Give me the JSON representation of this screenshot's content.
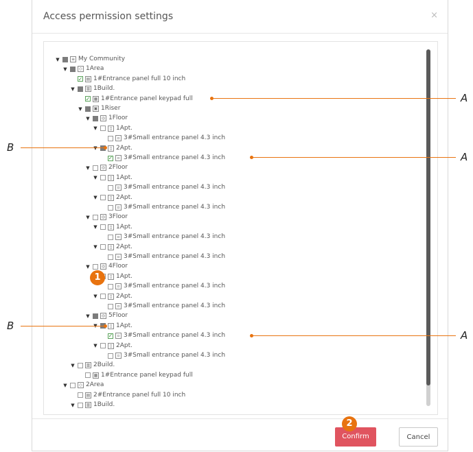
{
  "dialog": {
    "title": "Access permission settings",
    "close_glyph": "×",
    "confirm_label": "Confirm",
    "cancel_label": "Cancel"
  },
  "tree": [
    {
      "twisty": true,
      "check": "partial",
      "icon": "community-icon",
      "label": "My Community",
      "depth": 0
    },
    {
      "twisty": true,
      "check": "partial",
      "icon": "area-icon",
      "label": "1Area",
      "depth": 1
    },
    {
      "twisty": false,
      "check": "checked",
      "icon": "panel-icon",
      "label": "1#Entrance panel full 10 inch",
      "depth": 2
    },
    {
      "twisty": true,
      "check": "partial",
      "icon": "building-icon",
      "label": "1Build.",
      "depth": 2
    },
    {
      "twisty": false,
      "check": "checked",
      "icon": "keypad-icon",
      "label": "1#Entrance panel keypad full",
      "depth": 3
    },
    {
      "twisty": true,
      "check": "partial",
      "icon": "riser-icon",
      "label": "1Riser",
      "depth": 3
    },
    {
      "twisty": true,
      "check": "partial",
      "icon": "floor-icon",
      "label": "1Floor",
      "depth": 4
    },
    {
      "twisty": true,
      "check": "unchecked",
      "icon": "apartment-icon",
      "label": "1Apt.",
      "depth": 5
    },
    {
      "twisty": false,
      "check": "unchecked",
      "icon": "small-panel-icon",
      "label": "3#Small entrance panel 4.3 inch",
      "depth": 6
    },
    {
      "twisty": true,
      "check": "partial",
      "icon": "apartment-icon",
      "label": "2Apt.",
      "depth": 5
    },
    {
      "twisty": false,
      "check": "checked",
      "icon": "small-panel-icon",
      "label": "3#Small entrance panel 4.3 inch",
      "depth": 6
    },
    {
      "twisty": true,
      "check": "unchecked",
      "icon": "floor-icon",
      "label": "2Floor",
      "depth": 4
    },
    {
      "twisty": true,
      "check": "unchecked",
      "icon": "apartment-icon",
      "label": "1Apt.",
      "depth": 5
    },
    {
      "twisty": false,
      "check": "unchecked",
      "icon": "small-panel-icon",
      "label": "3#Small entrance panel 4.3 inch",
      "depth": 6
    },
    {
      "twisty": true,
      "check": "unchecked",
      "icon": "apartment-icon",
      "label": "2Apt.",
      "depth": 5
    },
    {
      "twisty": false,
      "check": "unchecked",
      "icon": "small-panel-icon",
      "label": "3#Small entrance panel 4.3 inch",
      "depth": 6
    },
    {
      "twisty": true,
      "check": "unchecked",
      "icon": "floor-icon",
      "label": "3Floor",
      "depth": 4
    },
    {
      "twisty": true,
      "check": "unchecked",
      "icon": "apartment-icon",
      "label": "1Apt.",
      "depth": 5
    },
    {
      "twisty": false,
      "check": "unchecked",
      "icon": "small-panel-icon",
      "label": "3#Small entrance panel 4.3 inch",
      "depth": 6
    },
    {
      "twisty": true,
      "check": "unchecked",
      "icon": "apartment-icon",
      "label": "2Apt.",
      "depth": 5
    },
    {
      "twisty": false,
      "check": "unchecked",
      "icon": "small-panel-icon",
      "label": "3#Small entrance panel 4.3 inch",
      "depth": 6
    },
    {
      "twisty": true,
      "check": "unchecked",
      "icon": "floor-icon",
      "label": "4Floor",
      "depth": 4
    },
    {
      "twisty": true,
      "check": "unchecked",
      "icon": "apartment-icon",
      "label": "1Apt.",
      "depth": 5
    },
    {
      "twisty": false,
      "check": "unchecked",
      "icon": "small-panel-icon",
      "label": "3#Small entrance panel 4.3 inch",
      "depth": 6
    },
    {
      "twisty": true,
      "check": "unchecked",
      "icon": "apartment-icon",
      "label": "2Apt.",
      "depth": 5
    },
    {
      "twisty": false,
      "check": "unchecked",
      "icon": "small-panel-icon",
      "label": "3#Small entrance panel 4.3 inch",
      "depth": 6
    },
    {
      "twisty": true,
      "check": "partial",
      "icon": "floor-icon",
      "label": "5Floor",
      "depth": 4
    },
    {
      "twisty": true,
      "check": "partial",
      "icon": "apartment-icon",
      "label": "1Apt.",
      "depth": 5
    },
    {
      "twisty": false,
      "check": "checked",
      "icon": "small-panel-icon",
      "label": "3#Small entrance panel 4.3 inch",
      "depth": 6
    },
    {
      "twisty": true,
      "check": "unchecked",
      "icon": "apartment-icon",
      "label": "2Apt.",
      "depth": 5
    },
    {
      "twisty": false,
      "check": "unchecked",
      "icon": "small-panel-icon",
      "label": "3#Small entrance panel 4.3 inch",
      "depth": 6
    },
    {
      "twisty": true,
      "check": "unchecked",
      "icon": "building-icon",
      "label": "2Build.",
      "depth": 2
    },
    {
      "twisty": false,
      "check": "unchecked",
      "icon": "keypad-icon",
      "label": "1#Entrance panel keypad full",
      "depth": 3
    },
    {
      "twisty": true,
      "check": "unchecked",
      "icon": "area-icon",
      "label": "2Area",
      "depth": 1
    },
    {
      "twisty": false,
      "check": "unchecked",
      "icon": "panel-icon",
      "label": "2#Entrance panel full 10 inch",
      "depth": 2
    },
    {
      "twisty": true,
      "check": "unchecked",
      "icon": "building-icon",
      "label": "1Build.",
      "depth": 2
    }
  ],
  "annotations": {
    "letter_a": "A",
    "letter_b": "B",
    "badge_1": "1",
    "badge_2": "2",
    "accent_color": "#e8730f"
  }
}
